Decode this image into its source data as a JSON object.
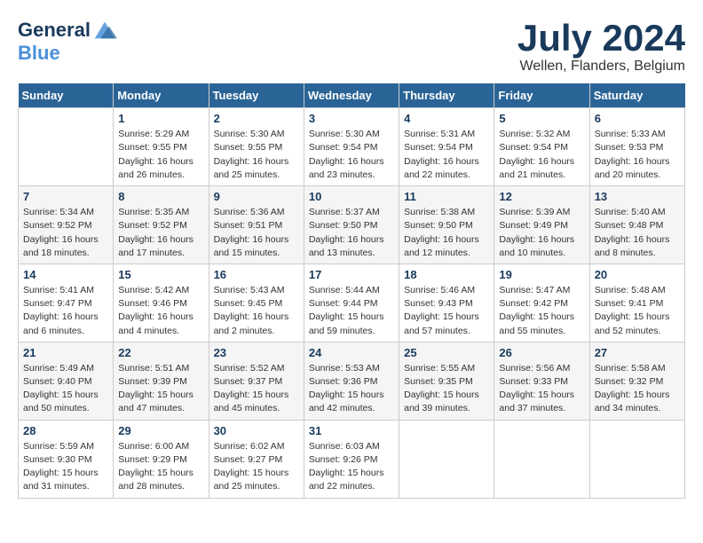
{
  "header": {
    "logo_line1": "General",
    "logo_line2": "Blue",
    "month_title": "July 2024",
    "location": "Wellen, Flanders, Belgium"
  },
  "days_of_week": [
    "Sunday",
    "Monday",
    "Tuesday",
    "Wednesday",
    "Thursday",
    "Friday",
    "Saturday"
  ],
  "weeks": [
    [
      {
        "day": "",
        "sunrise": "",
        "sunset": "",
        "daylight": ""
      },
      {
        "day": "1",
        "sunrise": "Sunrise: 5:29 AM",
        "sunset": "Sunset: 9:55 PM",
        "daylight": "Daylight: 16 hours and 26 minutes."
      },
      {
        "day": "2",
        "sunrise": "Sunrise: 5:30 AM",
        "sunset": "Sunset: 9:55 PM",
        "daylight": "Daylight: 16 hours and 25 minutes."
      },
      {
        "day": "3",
        "sunrise": "Sunrise: 5:30 AM",
        "sunset": "Sunset: 9:54 PM",
        "daylight": "Daylight: 16 hours and 23 minutes."
      },
      {
        "day": "4",
        "sunrise": "Sunrise: 5:31 AM",
        "sunset": "Sunset: 9:54 PM",
        "daylight": "Daylight: 16 hours and 22 minutes."
      },
      {
        "day": "5",
        "sunrise": "Sunrise: 5:32 AM",
        "sunset": "Sunset: 9:54 PM",
        "daylight": "Daylight: 16 hours and 21 minutes."
      },
      {
        "day": "6",
        "sunrise": "Sunrise: 5:33 AM",
        "sunset": "Sunset: 9:53 PM",
        "daylight": "Daylight: 16 hours and 20 minutes."
      }
    ],
    [
      {
        "day": "7",
        "sunrise": "Sunrise: 5:34 AM",
        "sunset": "Sunset: 9:52 PM",
        "daylight": "Daylight: 16 hours and 18 minutes."
      },
      {
        "day": "8",
        "sunrise": "Sunrise: 5:35 AM",
        "sunset": "Sunset: 9:52 PM",
        "daylight": "Daylight: 16 hours and 17 minutes."
      },
      {
        "day": "9",
        "sunrise": "Sunrise: 5:36 AM",
        "sunset": "Sunset: 9:51 PM",
        "daylight": "Daylight: 16 hours and 15 minutes."
      },
      {
        "day": "10",
        "sunrise": "Sunrise: 5:37 AM",
        "sunset": "Sunset: 9:50 PM",
        "daylight": "Daylight: 16 hours and 13 minutes."
      },
      {
        "day": "11",
        "sunrise": "Sunrise: 5:38 AM",
        "sunset": "Sunset: 9:50 PM",
        "daylight": "Daylight: 16 hours and 12 minutes."
      },
      {
        "day": "12",
        "sunrise": "Sunrise: 5:39 AM",
        "sunset": "Sunset: 9:49 PM",
        "daylight": "Daylight: 16 hours and 10 minutes."
      },
      {
        "day": "13",
        "sunrise": "Sunrise: 5:40 AM",
        "sunset": "Sunset: 9:48 PM",
        "daylight": "Daylight: 16 hours and 8 minutes."
      }
    ],
    [
      {
        "day": "14",
        "sunrise": "Sunrise: 5:41 AM",
        "sunset": "Sunset: 9:47 PM",
        "daylight": "Daylight: 16 hours and 6 minutes."
      },
      {
        "day": "15",
        "sunrise": "Sunrise: 5:42 AM",
        "sunset": "Sunset: 9:46 PM",
        "daylight": "Daylight: 16 hours and 4 minutes."
      },
      {
        "day": "16",
        "sunrise": "Sunrise: 5:43 AM",
        "sunset": "Sunset: 9:45 PM",
        "daylight": "Daylight: 16 hours and 2 minutes."
      },
      {
        "day": "17",
        "sunrise": "Sunrise: 5:44 AM",
        "sunset": "Sunset: 9:44 PM",
        "daylight": "Daylight: 15 hours and 59 minutes."
      },
      {
        "day": "18",
        "sunrise": "Sunrise: 5:46 AM",
        "sunset": "Sunset: 9:43 PM",
        "daylight": "Daylight: 15 hours and 57 minutes."
      },
      {
        "day": "19",
        "sunrise": "Sunrise: 5:47 AM",
        "sunset": "Sunset: 9:42 PM",
        "daylight": "Daylight: 15 hours and 55 minutes."
      },
      {
        "day": "20",
        "sunrise": "Sunrise: 5:48 AM",
        "sunset": "Sunset: 9:41 PM",
        "daylight": "Daylight: 15 hours and 52 minutes."
      }
    ],
    [
      {
        "day": "21",
        "sunrise": "Sunrise: 5:49 AM",
        "sunset": "Sunset: 9:40 PM",
        "daylight": "Daylight: 15 hours and 50 minutes."
      },
      {
        "day": "22",
        "sunrise": "Sunrise: 5:51 AM",
        "sunset": "Sunset: 9:39 PM",
        "daylight": "Daylight: 15 hours and 47 minutes."
      },
      {
        "day": "23",
        "sunrise": "Sunrise: 5:52 AM",
        "sunset": "Sunset: 9:37 PM",
        "daylight": "Daylight: 15 hours and 45 minutes."
      },
      {
        "day": "24",
        "sunrise": "Sunrise: 5:53 AM",
        "sunset": "Sunset: 9:36 PM",
        "daylight": "Daylight: 15 hours and 42 minutes."
      },
      {
        "day": "25",
        "sunrise": "Sunrise: 5:55 AM",
        "sunset": "Sunset: 9:35 PM",
        "daylight": "Daylight: 15 hours and 39 minutes."
      },
      {
        "day": "26",
        "sunrise": "Sunrise: 5:56 AM",
        "sunset": "Sunset: 9:33 PM",
        "daylight": "Daylight: 15 hours and 37 minutes."
      },
      {
        "day": "27",
        "sunrise": "Sunrise: 5:58 AM",
        "sunset": "Sunset: 9:32 PM",
        "daylight": "Daylight: 15 hours and 34 minutes."
      }
    ],
    [
      {
        "day": "28",
        "sunrise": "Sunrise: 5:59 AM",
        "sunset": "Sunset: 9:30 PM",
        "daylight": "Daylight: 15 hours and 31 minutes."
      },
      {
        "day": "29",
        "sunrise": "Sunrise: 6:00 AM",
        "sunset": "Sunset: 9:29 PM",
        "daylight": "Daylight: 15 hours and 28 minutes."
      },
      {
        "day": "30",
        "sunrise": "Sunrise: 6:02 AM",
        "sunset": "Sunset: 9:27 PM",
        "daylight": "Daylight: 15 hours and 25 minutes."
      },
      {
        "day": "31",
        "sunrise": "Sunrise: 6:03 AM",
        "sunset": "Sunset: 9:26 PM",
        "daylight": "Daylight: 15 hours and 22 minutes."
      },
      {
        "day": "",
        "sunrise": "",
        "sunset": "",
        "daylight": ""
      },
      {
        "day": "",
        "sunrise": "",
        "sunset": "",
        "daylight": ""
      },
      {
        "day": "",
        "sunrise": "",
        "sunset": "",
        "daylight": ""
      }
    ]
  ]
}
